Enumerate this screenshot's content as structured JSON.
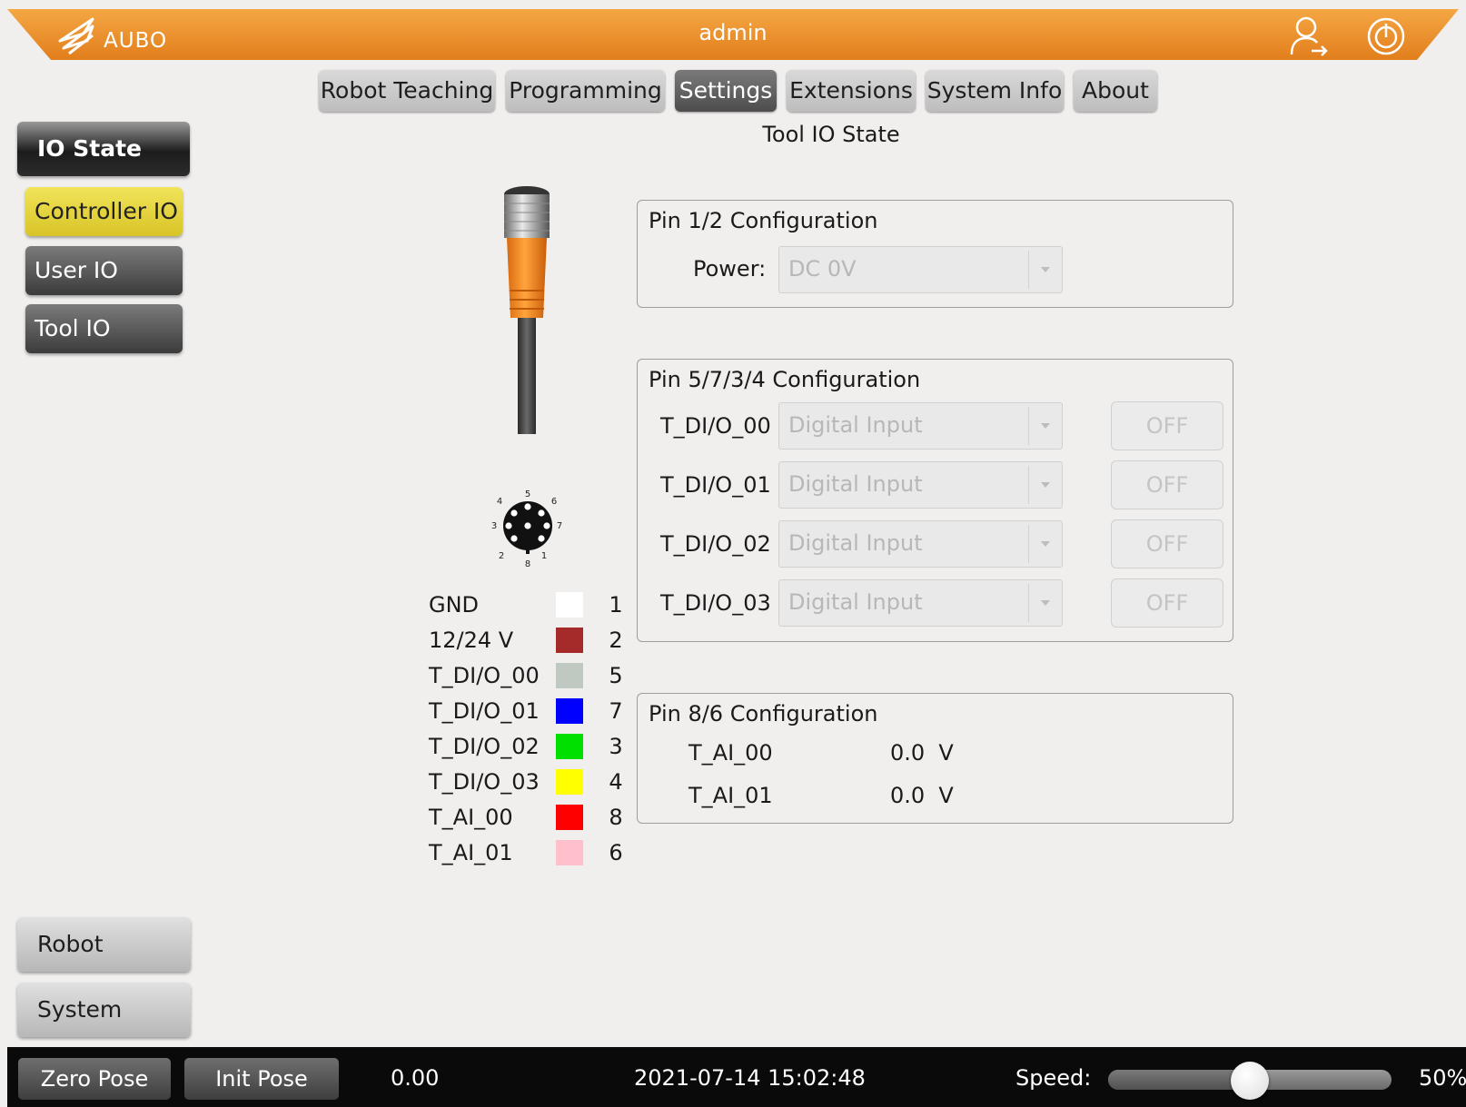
{
  "header": {
    "brand": "AUBO",
    "user": "admin",
    "colors": {
      "bar": "#f0a040",
      "bar_dark": "#e07a18"
    }
  },
  "tabs": [
    {
      "label": "Robot Teaching",
      "active": false
    },
    {
      "label": "Programming",
      "active": false
    },
    {
      "label": "Settings",
      "active": true
    },
    {
      "label": "Extensions",
      "active": false
    },
    {
      "label": "System Info",
      "active": false
    },
    {
      "label": "About",
      "active": false
    }
  ],
  "page_title": "Tool IO State",
  "sidebar": {
    "section": "IO State",
    "items": [
      {
        "label": "Controller IO",
        "active": true
      },
      {
        "label": "User IO",
        "active": false
      },
      {
        "label": "Tool IO",
        "active": false
      }
    ],
    "bottom": [
      "Robot",
      "System"
    ]
  },
  "connector_pin_numbers": [
    "1",
    "2",
    "3",
    "4",
    "5",
    "6",
    "7",
    "8"
  ],
  "pins": [
    {
      "label": "GND",
      "color": "#ffffff",
      "pin": "1"
    },
    {
      "label": "12/24 V",
      "color": "#a52a2a",
      "pin": "2"
    },
    {
      "label": "T_DI/O_00",
      "color": "#c0c8c2",
      "pin": "5"
    },
    {
      "label": "T_DI/O_01",
      "color": "#0000ff",
      "pin": "7"
    },
    {
      "label": "T_DI/O_02",
      "color": "#00e000",
      "pin": "3"
    },
    {
      "label": "T_DI/O_03",
      "color": "#ffff00",
      "pin": "4"
    },
    {
      "label": "T_AI_00",
      "color": "#ff0000",
      "pin": "8"
    },
    {
      "label": "T_AI_01",
      "color": "#ffc0cb",
      "pin": "6"
    }
  ],
  "pin12": {
    "title": "Pin 1/2 Configuration",
    "power_label": "Power:",
    "power_value": "DC 0V"
  },
  "pin5734": {
    "title": "Pin 5/7/3/4  Configuration",
    "rows": [
      {
        "label": "T_DI/O_00",
        "mode": "Digital Input",
        "state": "OFF"
      },
      {
        "label": "T_DI/O_01",
        "mode": "Digital Input",
        "state": "OFF"
      },
      {
        "label": "T_DI/O_02",
        "mode": "Digital Input",
        "state": "OFF"
      },
      {
        "label": "T_DI/O_03",
        "mode": "Digital Input",
        "state": "OFF"
      }
    ]
  },
  "pin86": {
    "title": "Pin 8/6 Configuration",
    "rows": [
      {
        "label": "T_AI_00",
        "value": "0.0  V"
      },
      {
        "label": "T_AI_01",
        "value": "0.0  V"
      }
    ]
  },
  "bottombar": {
    "zero_pose": "Zero Pose",
    "init_pose": "Init Pose",
    "value": "0.00",
    "datetime": "2021-07-14 15:02:48",
    "speed_label": "Speed:",
    "speed_text": "50%",
    "speed_fraction": 0.5
  }
}
